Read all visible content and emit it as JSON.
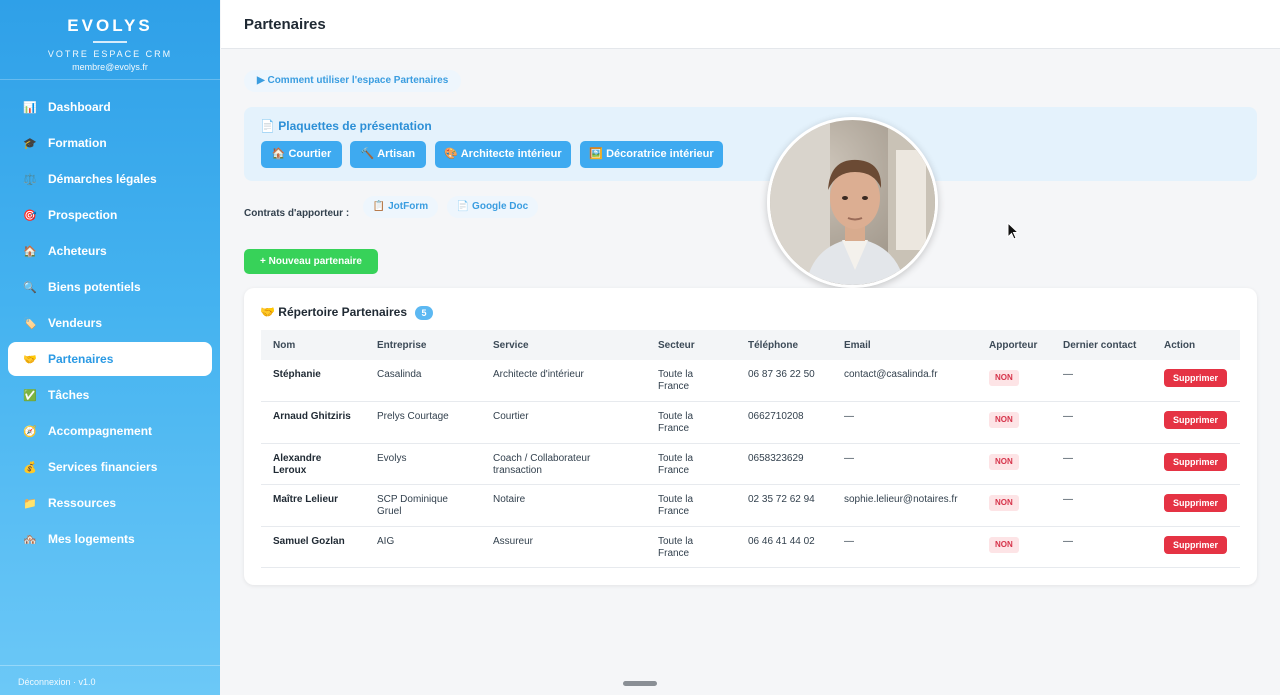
{
  "brand": {
    "name": "EVOLYS",
    "tagline": "VOTRE ESPACE CRM",
    "email": "membre@evolys.fr"
  },
  "sidebar": {
    "items": [
      {
        "label": "Dashboard",
        "icon": "📊",
        "icon_name": "chart-icon"
      },
      {
        "label": "Formation",
        "icon": "🎓",
        "icon_name": "graduation-cap-icon"
      },
      {
        "label": "Démarches légales",
        "icon": "⚖️",
        "icon_name": "scales-icon"
      },
      {
        "label": "Prospection",
        "icon": "🎯",
        "icon_name": "target-icon"
      },
      {
        "label": "Acheteurs",
        "icon": "🏠",
        "icon_name": "house-icon"
      },
      {
        "label": "Biens potentiels",
        "icon": "🔍",
        "icon_name": "magnifier-icon"
      },
      {
        "label": "Vendeurs",
        "icon": "🏷️",
        "icon_name": "tag-icon"
      },
      {
        "label": "Partenaires",
        "icon": "🤝",
        "icon_name": "handshake-icon",
        "active": true
      },
      {
        "label": "Tâches",
        "icon": "✅",
        "icon_name": "checkbox-icon"
      },
      {
        "label": "Accompagnement",
        "icon": "🧭",
        "icon_name": "compass-icon"
      },
      {
        "label": "Services financiers",
        "icon": "💰",
        "icon_name": "money-bag-icon"
      },
      {
        "label": "Ressources",
        "icon": "📁",
        "icon_name": "folder-icon"
      },
      {
        "label": "Mes logements",
        "icon": "🏘️",
        "icon_name": "houses-icon"
      }
    ],
    "footer": "Déconnexion · v1.0"
  },
  "header": {
    "title": "Partenaires"
  },
  "guide_link": "▶ Comment utiliser l'espace Partenaires",
  "plaquettes": {
    "title": "📄 Plaquettes de présentation",
    "buttons": [
      {
        "label": "🏠 Courtier"
      },
      {
        "label": "🔨 Artisan"
      },
      {
        "label": "🎨 Architecte intérieur"
      },
      {
        "label": "🖼️ Décoratrice intérieur"
      }
    ]
  },
  "contrats": {
    "label": "Contrats d'apporteur :",
    "links": [
      {
        "label": "📋 JotForm"
      },
      {
        "label": "📄 Google Doc"
      }
    ]
  },
  "new_partner_button": "+ Nouveau partenaire",
  "directory": {
    "title": "🤝 Répertoire Partenaires",
    "count": "5",
    "columns": [
      "Nom",
      "Entreprise",
      "Service",
      "Secteur",
      "Téléphone",
      "Email",
      "Apporteur",
      "Dernier contact",
      "Action"
    ],
    "rows": [
      {
        "nom": "Stéphanie",
        "entreprise": "Casalinda",
        "service": "Architecte d'intérieur",
        "secteur": "Toute la France",
        "telephone": "06 87 36 22 50",
        "email": "contact@casalinda.fr",
        "apporteur": "NON",
        "dernier_contact": "—",
        "action": "Supprimer"
      },
      {
        "nom": "Arnaud Ghitziris",
        "entreprise": "Prelys Courtage",
        "service": "Courtier",
        "secteur": "Toute la France",
        "telephone": "0662710208",
        "email": "—",
        "apporteur": "NON",
        "dernier_contact": "—",
        "action": "Supprimer"
      },
      {
        "nom": "Alexandre Leroux",
        "entreprise": "Evolys",
        "service": "Coach / Collaborateur transaction",
        "secteur": "Toute la France",
        "telephone": "0658323629",
        "email": "—",
        "apporteur": "NON",
        "dernier_contact": "—",
        "action": "Supprimer"
      },
      {
        "nom": "Maître Lelieur",
        "entreprise": "SCP Dominique Gruel",
        "service": "Notaire",
        "secteur": "Toute la France",
        "telephone": "02 35 72 62 94",
        "email": "sophie.lelieur@notaires.fr",
        "apporteur": "NON",
        "dernier_contact": "—",
        "action": "Supprimer"
      },
      {
        "nom": "Samuel Gozlan",
        "entreprise": "AIG",
        "service": "Assureur",
        "secteur": "Toute la France",
        "telephone": "06 46 41 44 02",
        "email": "—",
        "apporteur": "NON",
        "dernier_contact": "—",
        "action": "Supprimer"
      }
    ]
  },
  "colors": {
    "accent": "#2fa0e8",
    "success": "#37d259",
    "danger": "#e53344"
  }
}
